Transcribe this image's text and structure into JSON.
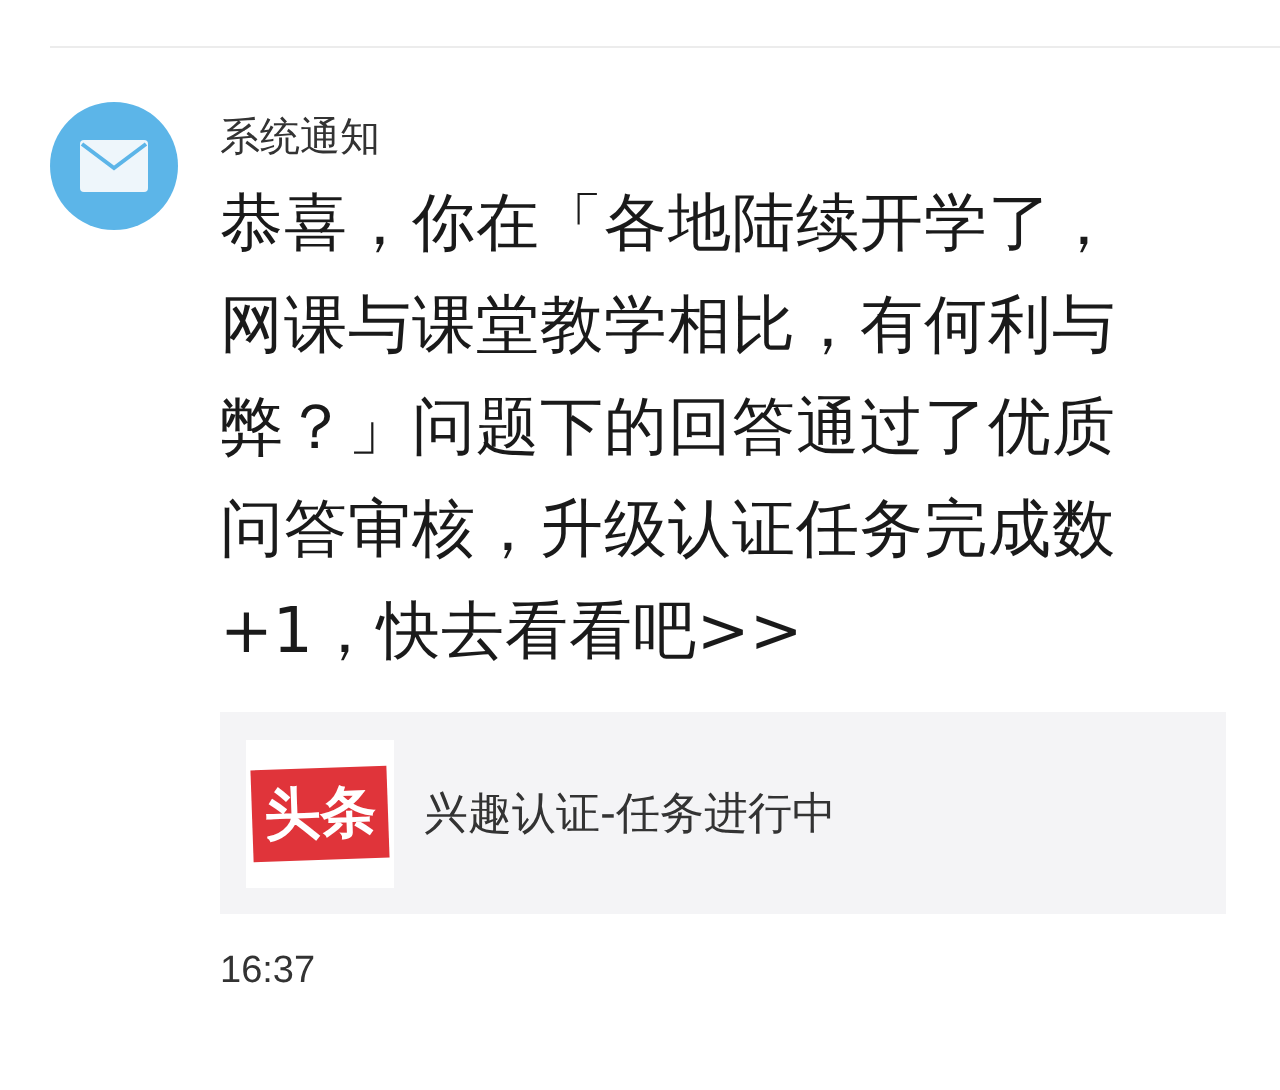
{
  "notification": {
    "sender": "系统通知",
    "message": "恭喜，你在「各地陆续开学了，网课与课堂教学相比，有何利与弊？」问题下的回答通过了优质问答审核，升级认证任务完成数+1，快去看看吧>>",
    "card": {
      "logo_text": "头条",
      "title": "兴趣认证-任务进行中"
    },
    "time": "16:37"
  }
}
